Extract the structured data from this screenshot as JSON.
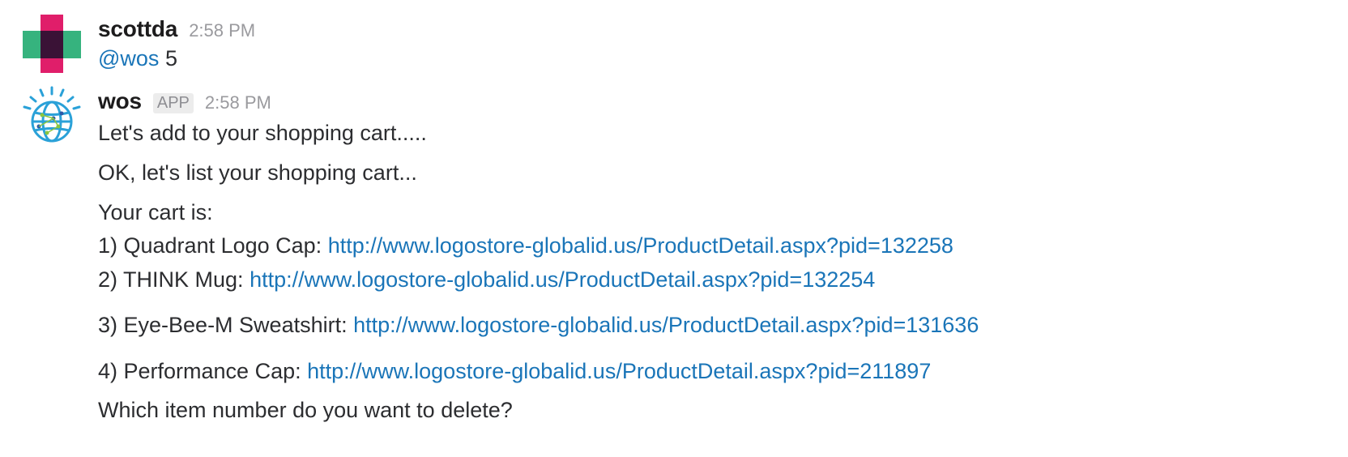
{
  "messages": {
    "first": {
      "author": "scottda",
      "time": "2:58 PM",
      "mention": "@wos",
      "text": "5"
    },
    "second": {
      "author": "wos",
      "badge": "APP",
      "time": "2:58 PM",
      "line1": "Let's add  to your shopping cart.....",
      "line2": "OK, let's list your shopping cart...",
      "line3": "Your cart is:",
      "items": [
        {
          "label": "1) Quadrant Logo Cap: ",
          "url": "http://www.logostore-globalid.us/ProductDetail.aspx?pid=132258"
        },
        {
          "label": "2) THINK Mug: ",
          "url": "http://www.logostore-globalid.us/ProductDetail.aspx?pid=132254"
        },
        {
          "label": "3) Eye-Bee-M Sweatshirt: ",
          "url": "http://www.logostore-globalid.us/ProductDetail.aspx?pid=131636"
        },
        {
          "label": "4) Performance Cap: ",
          "url": "http://www.logostore-globalid.us/ProductDetail.aspx?pid=211897"
        }
      ],
      "question": "Which item number do you want to delete?"
    }
  },
  "colors": {
    "link": "#1a75b8",
    "avatar_magenta": "#e01e6a",
    "avatar_green": "#36b37e",
    "avatar_dark": "#3a1236",
    "watson_blue": "#2aa1d8"
  },
  "icons": {
    "first_avatar": "scottda-avatar",
    "second_avatar": "watson-globe-icon"
  }
}
